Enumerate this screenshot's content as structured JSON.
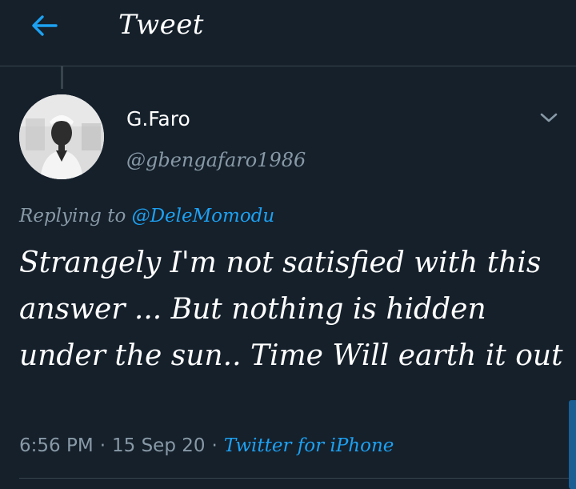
{
  "header": {
    "title": "Tweet",
    "back_icon": "arrow-left-icon"
  },
  "tweet": {
    "author": {
      "display_name": "G.Faro",
      "handle": "@gbengafaro1986"
    },
    "replying_to_label": "Replying to",
    "replying_to_handle": "@DeleMomodu",
    "text": "Strangely I'm not satisfied with this answer ... But nothing is hidden under the sun.. Time Will earth it out",
    "time": "6:56 PM",
    "date": "15 Sep 20",
    "separator": "·",
    "source": "Twitter for iPhone"
  },
  "colors": {
    "background": "#15202b",
    "accent": "#1da1f2",
    "secondary_text": "#8899a6",
    "divider": "#38444d"
  }
}
